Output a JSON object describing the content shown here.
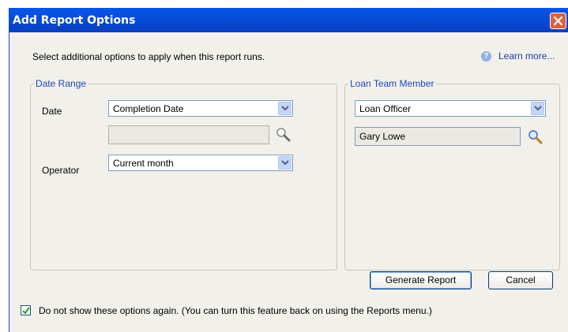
{
  "window": {
    "title": "Add Report Options"
  },
  "intro": "Select additional options to apply when this report runs.",
  "learn_more": "Learn more...",
  "date_range": {
    "legend": "Date Range",
    "date_label": "Date",
    "date_value": "Completion Date",
    "value_field": "",
    "operator_label": "Operator",
    "operator_value": "Current month"
  },
  "loan_team": {
    "legend": "Loan Team Member",
    "role_value": "Loan Officer",
    "member_value": "Gary Lowe"
  },
  "buttons": {
    "generate": "Generate Report",
    "cancel": "Cancel"
  },
  "dont_show": {
    "checked": true,
    "label": "Do not show these options again. (You can turn this feature back on using the Reports menu.)"
  },
  "colors": {
    "titlebar": "#0a56e8",
    "dialog_bg": "#f1f0ea",
    "legend_text": "#2047b8",
    "close": "#e0603d"
  }
}
